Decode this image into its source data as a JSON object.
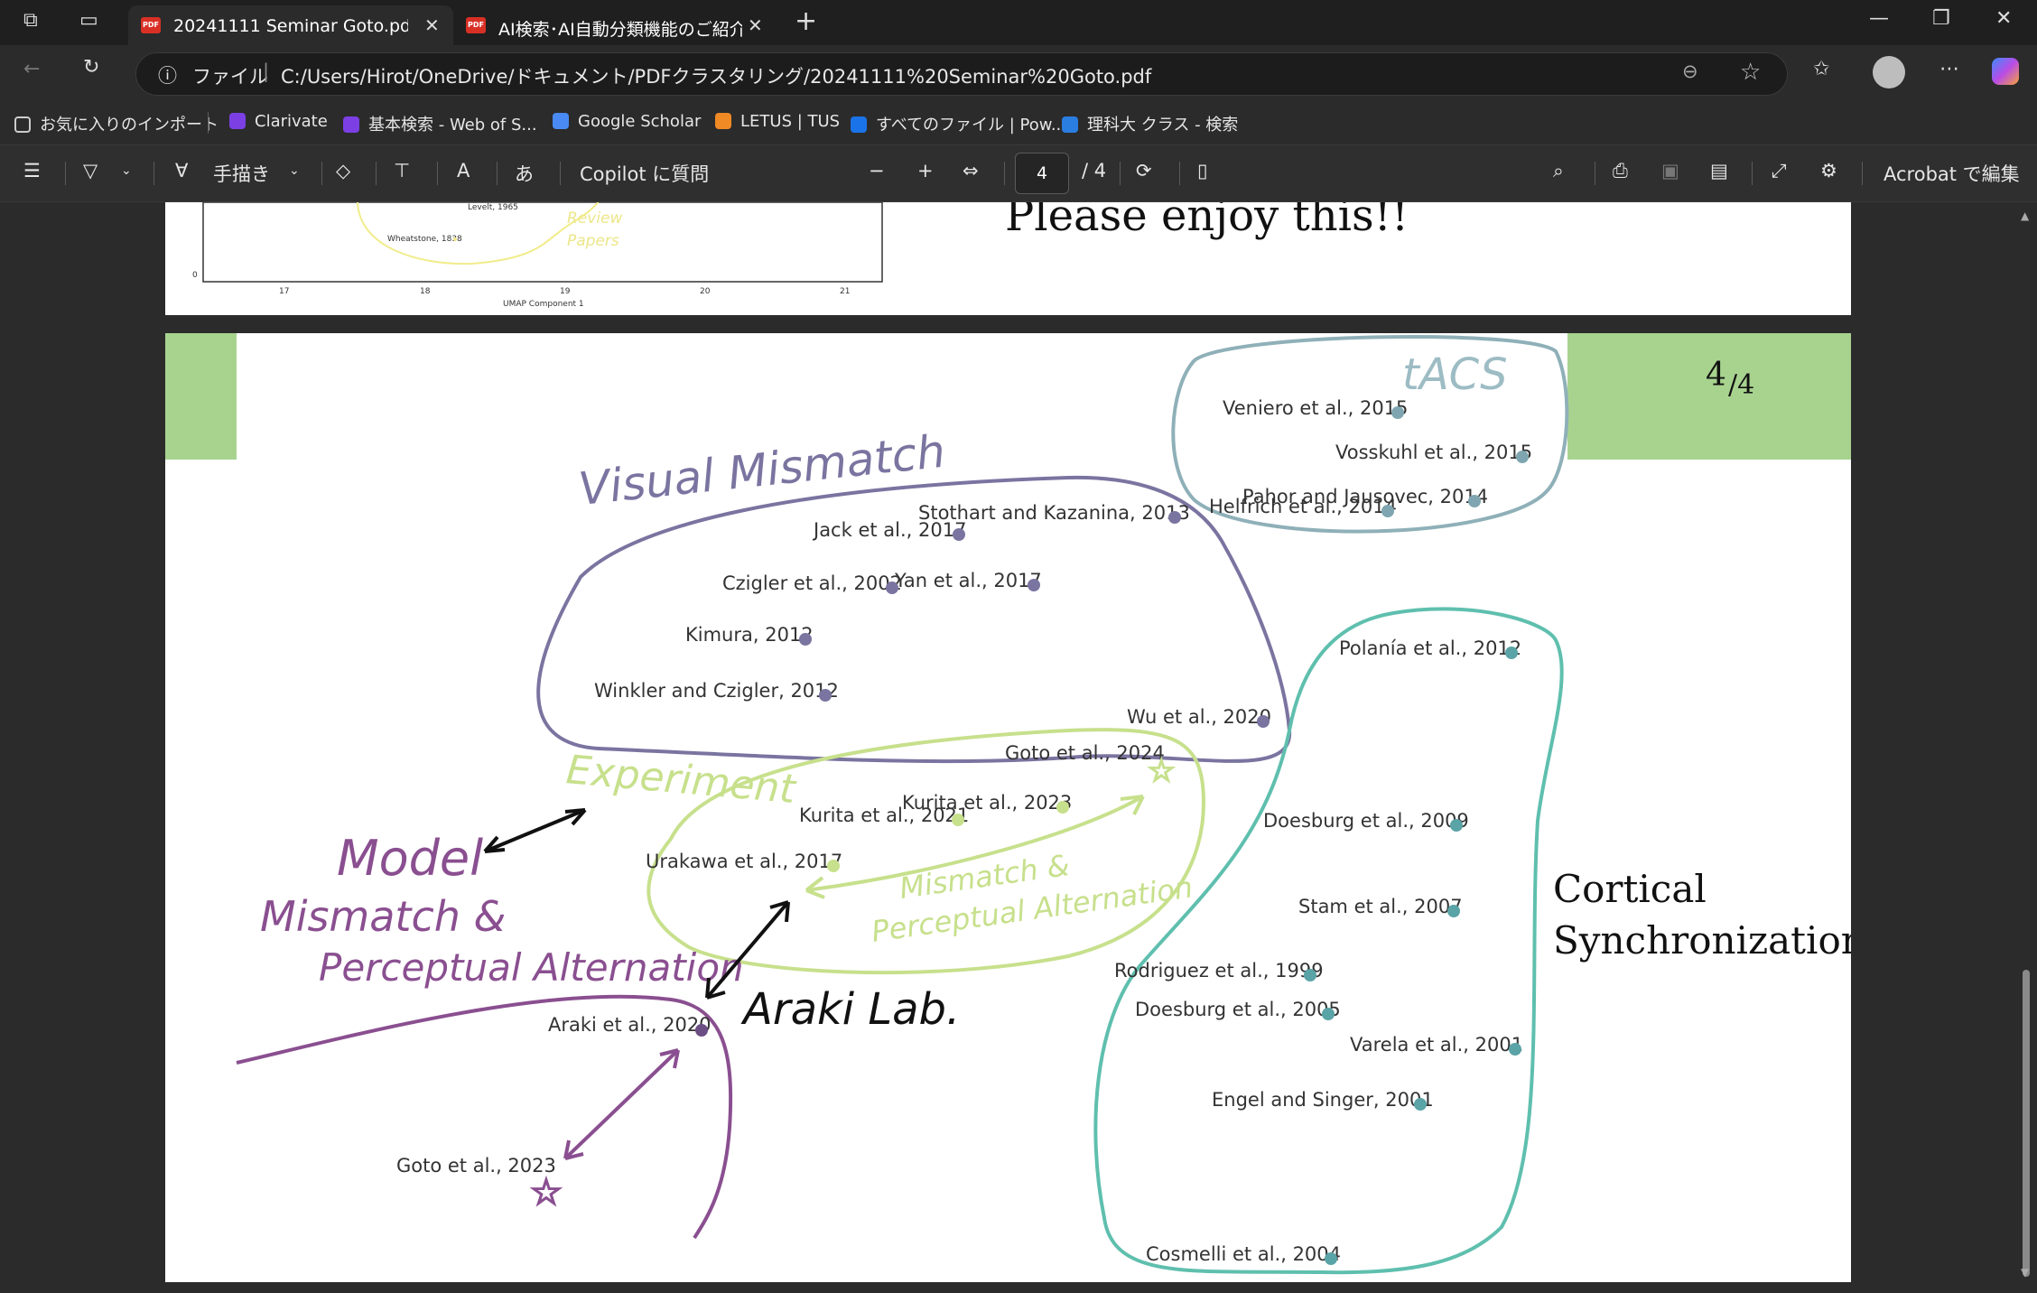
{
  "browser": {
    "tabs": [
      {
        "title": "20241111 Seminar Goto.pdf",
        "active": true
      },
      {
        "title": "AI検索･AI自動分類機能のご紹介資",
        "active": false
      }
    ],
    "address": {
      "prefix": "ファイル",
      "url": "C:/Users/Hirot/OneDrive/ドキュメント/PDFクラスタリング/20241111%20Seminar%20Goto.pdf"
    },
    "bookmarks": [
      "お気に入りのインポート",
      "Clarivate",
      "基本検索 - Web of S...",
      "Google Scholar",
      "LETUS | TUS",
      "すべてのファイル | Pow...",
      "理科大 クラス - 検索"
    ]
  },
  "pdf_toolbar": {
    "draw_label": "手描き",
    "copilot_label": "Copilot に質問",
    "current_page": "4",
    "total_pages": "/ 4",
    "edit_label": "Acrobat で編集"
  },
  "page3": {
    "text": "Please enjoy this!!",
    "plot_labels": {
      "wheatstone": "Wheatstone, 1838",
      "levelt": "Levelt, 1965",
      "review": "Review",
      "papers": "Papers",
      "zero": "0",
      "xlabel": "UMAP Component 1",
      "ticks": [
        "17",
        "18",
        "19",
        "20",
        "21"
      ]
    }
  },
  "page4": {
    "page_number": "4",
    "page_total": "/4",
    "labels": {
      "visual_mismatch": "Visual Mismatch",
      "tacs": "tACS",
      "experiment": "Experiment",
      "model": "Model",
      "mismatch_perceptual": "Mismatch &",
      "perceptual_alternation": "Perceptual Alternation",
      "mismatch_inner_1": "Mismatch &",
      "mismatch_inner_2": "Perceptual Alternation",
      "araki_lab": "Araki Lab.",
      "cortical_1": "Cortical",
      "cortical_2": "Synchronization"
    },
    "citations": {
      "veniero": "Veniero et al., 2015",
      "vosskuhl": "Vosskuhl et al., 2015",
      "pahor": "Pahor and Jausovec, 2014",
      "helfrich": "Helfrich et al., 2014",
      "stothart": "Stothart and Kazanina, 2013",
      "jack": "Jack et al., 2017",
      "czigler": "Czigler et al., 2002",
      "yan": "Yan et al., 2017",
      "kimura": "Kimura, 2012",
      "winkler": "Winkler and Czigler, 2012",
      "wu": "Wu et al., 2020",
      "goto2024": "Goto et al., 2024",
      "kurita2023": "Kurita et al., 2023",
      "kurita2021": "Kurita et al., 2021",
      "urakawa": "Urakawa et al., 2017",
      "araki": "Araki et al., 2020",
      "goto2023": "Goto et al., 2023",
      "polania": "Polanía et al., 2012",
      "doesburg2009": "Doesburg et al., 2009",
      "stam": "Stam et al., 2007",
      "rodriguez": "Rodriguez et al., 1999",
      "doesburg2005": "Doesburg et al., 2005",
      "varela": "Varela et al., 2001",
      "engel": "Engel and Singer, 2001",
      "cosmelli": "Cosmelli et al., 2004"
    }
  },
  "colors": {
    "visual": "#7a74a0",
    "tacs": "#8fb0b8",
    "experiment": "#c7e08c",
    "model": "#8a4f90",
    "cortical": "#5fbfae",
    "header_green": "#a8d38f"
  }
}
